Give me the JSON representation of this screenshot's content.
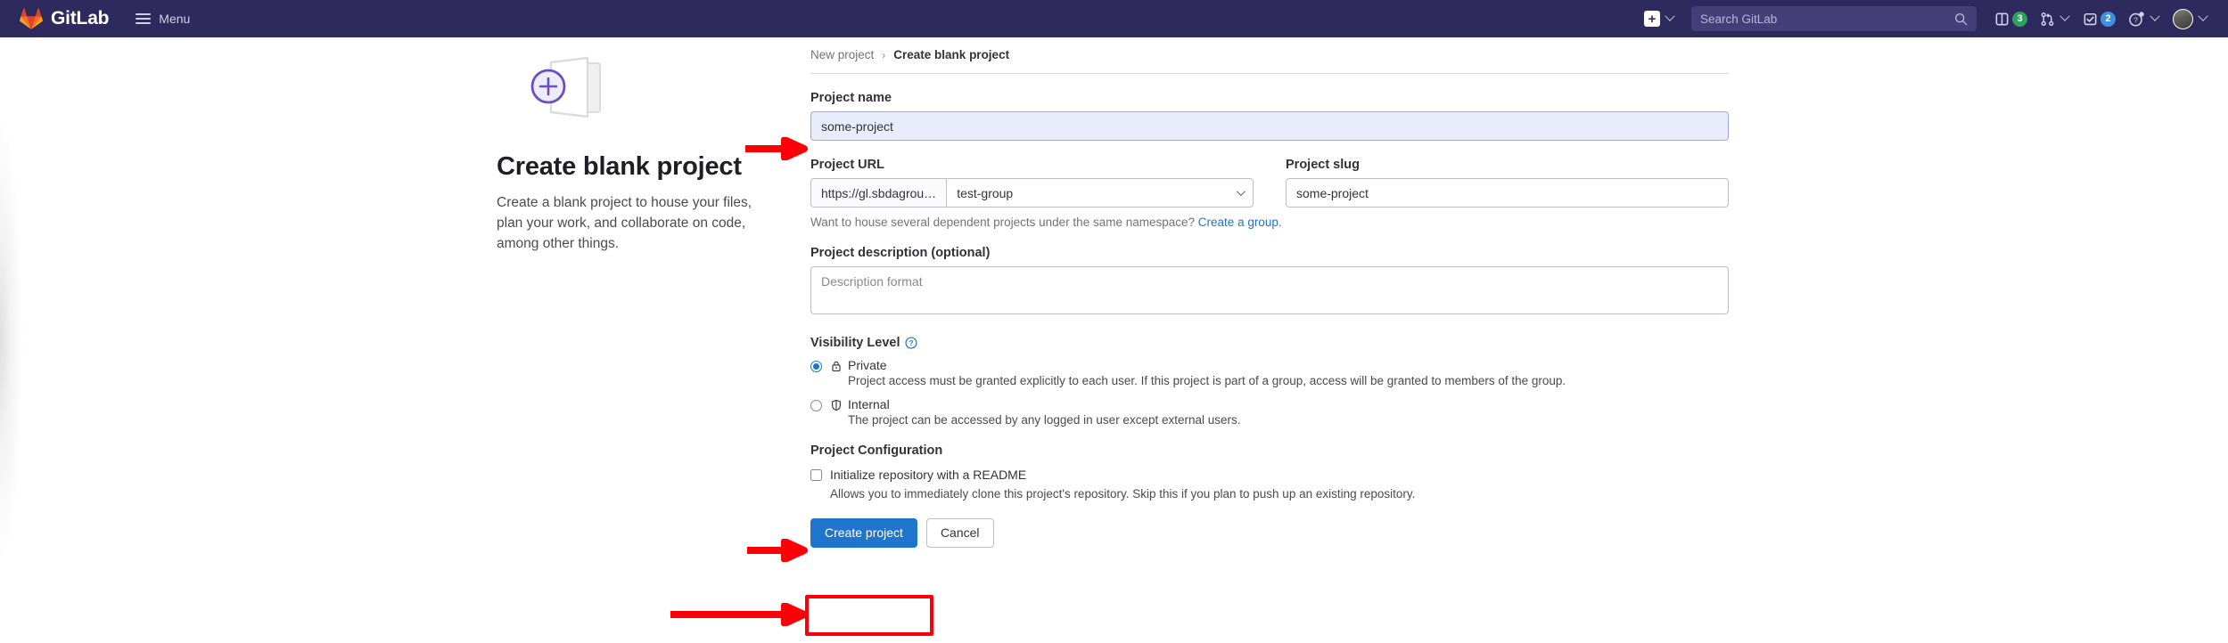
{
  "navbar": {
    "brand": "GitLab",
    "menu_label": "Menu",
    "new_button_icon": "plus-square-icon",
    "search_placeholder": "Search GitLab",
    "search_icon": "search-icon",
    "items": [
      {
        "icon": "issues-list-icon",
        "badge": "3",
        "badge_color": "#2da160",
        "name": "issues"
      },
      {
        "icon": "merge-request-icon",
        "badge": "",
        "badge_color": "",
        "name": "merge-requests"
      },
      {
        "icon": "todo-checkbox-icon",
        "badge": "2",
        "badge_color": "#428fdc",
        "name": "todos"
      },
      {
        "icon": "help-question-icon",
        "badge": "",
        "badge_color": "",
        "name": "help"
      }
    ],
    "avatar_name": "user-avatar"
  },
  "breadcrumb": {
    "parent": "New project",
    "separator": "›",
    "current": "Create blank project"
  },
  "aside": {
    "illustration": "blank-project-illustration",
    "title": "Create blank project",
    "description": "Create a blank project to house your files, plan your work, and collaborate on code, among other things."
  },
  "form": {
    "project_name": {
      "label": "Project name",
      "value": "some-project",
      "placeholder": ""
    },
    "project_url": {
      "label": "Project URL",
      "prefix": "https://gl.sbdagrou…",
      "namespace": "test-group"
    },
    "project_slug": {
      "label": "Project slug",
      "value": "some-project",
      "placeholder": ""
    },
    "namespace_helper": {
      "text": "Want to house several dependent projects under the same namespace?",
      "link_text": "Create a group."
    },
    "description": {
      "label": "Project description (optional)",
      "value": "",
      "placeholder": "Description format"
    },
    "visibility": {
      "label": "Visibility Level",
      "help_icon": "question-circle-icon",
      "options": [
        {
          "id": "private",
          "icon": "lock-icon",
          "name": "Private",
          "description": "Project access must be granted explicitly to each user. If this project is part of a group, access will be granted to members of the group.",
          "selected": true
        },
        {
          "id": "internal",
          "icon": "shield-icon",
          "name": "Internal",
          "description": "The project can be accessed by any logged in user except external users.",
          "selected": false
        }
      ]
    },
    "configuration": {
      "label": "Project Configuration",
      "readme": {
        "label": "Initialize repository with a README",
        "description": "Allows you to immediately clone this project's repository. Skip this if you plan to push up an existing repository.",
        "checked": false
      }
    },
    "actions": {
      "submit_label": "Create project",
      "cancel_label": "Cancel"
    }
  },
  "annotations": {
    "arrow_color": "#fb0007",
    "highlight_color": "#fb0007",
    "arrows": [
      {
        "target": "project-name-input"
      },
      {
        "target": "readme-checkbox"
      },
      {
        "target": "create-project-button"
      }
    ],
    "highlight_box": {
      "target": "create-project-button"
    }
  },
  "theme": {
    "navbar_bg": "#2e2a5d",
    "primary": "#1f75cb",
    "link": "#1f75cb",
    "focus_bg": "#e9ecfb"
  }
}
